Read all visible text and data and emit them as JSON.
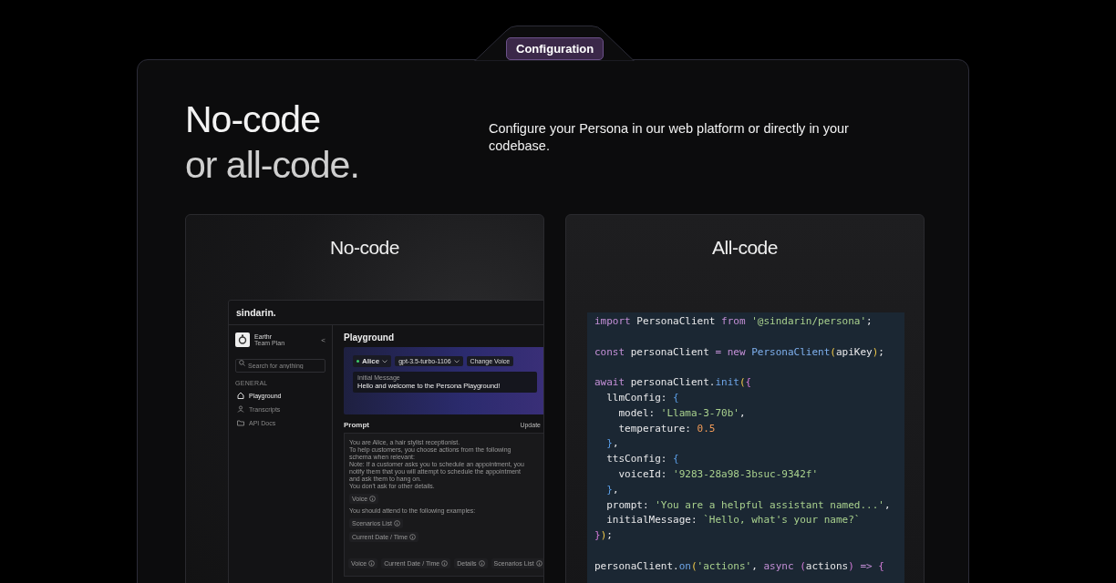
{
  "badge": "Configuration",
  "heading": [
    "No-code",
    "or all-code."
  ],
  "description": "Configure your Persona in our web platform or directly in your codebase.",
  "no_code_card": {
    "title": "No-code",
    "app": {
      "logo": "sindarin.",
      "workspace": {
        "name": "Earthr",
        "plan": "Team Plan",
        "collapse": "<"
      },
      "search": {
        "placeholder": "Search for anything"
      },
      "section": "GENERAL",
      "nav": [
        {
          "label": "Playground",
          "selected": true
        },
        {
          "label": "Transcripts",
          "selected": false
        },
        {
          "label": "API Docs",
          "selected": false
        }
      ],
      "page_title": "Playground",
      "persona": "Alice",
      "model": "gpt-3.5-turbo-1106",
      "change_voice": "Change Voice",
      "initial_message": {
        "label": "Initial Message",
        "value": "Hello and welcome to the Persona Playground!"
      },
      "prompt_title": "Prompt",
      "update": "Update",
      "prompt": [
        {
          "kind": "text",
          "text": "You are Alice, a hair stylist receptionist.\nTo help customers, you choose actions from the following\nschema when relevant:\nNote: If a customer asks you to schedule an appointment, you\nnotify them that you will attempt to schedule the appointment\nand ask them to hang on.\nYou don't ask for other details."
        },
        {
          "kind": "chip",
          "text": "Voice"
        },
        {
          "kind": "text",
          "text": "You should attend to the following examples:"
        },
        {
          "kind": "chip",
          "text": "Scenarios List"
        },
        {
          "kind": "chip",
          "text": "Current Date / Time"
        }
      ],
      "variables": [
        "Voice",
        "Current Date / Time",
        "Details",
        "Scenarios List"
      ]
    }
  },
  "all_code_card": {
    "title": "All-code",
    "code": [
      {
        "kind": "code",
        "tokens": [
          {
            "kind": "kw",
            "text": "import"
          },
          {
            "kind": "id",
            "text": " PersonaClient "
          },
          {
            "kind": "kw",
            "text": "from"
          },
          {
            "kind": "str",
            "text": " '@sindarin/persona'"
          },
          {
            "kind": "id",
            "text": ";"
          }
        ]
      },
      {
        "kind": "blank"
      },
      {
        "kind": "code",
        "tokens": [
          {
            "kind": "kw",
            "text": "const"
          },
          {
            "kind": "id",
            "text": " personaClient "
          },
          {
            "kind": "op",
            "text": "="
          },
          {
            "kind": "kw",
            "text": " new "
          },
          {
            "kind": "cls",
            "text": "PersonaClient"
          },
          {
            "kind": "p1",
            "text": "("
          },
          {
            "kind": "id",
            "text": "apiKey"
          },
          {
            "kind": "p1",
            "text": ")"
          },
          {
            "kind": "id",
            "text": ";"
          }
        ]
      },
      {
        "kind": "blank"
      },
      {
        "kind": "code",
        "tokens": [
          {
            "kind": "kw",
            "text": "await"
          },
          {
            "kind": "id",
            "text": " personaClient."
          },
          {
            "kind": "fn",
            "text": "init"
          },
          {
            "kind": "p1",
            "text": "("
          },
          {
            "kind": "p2",
            "text": "{"
          }
        ]
      },
      {
        "kind": "code",
        "tokens": [
          {
            "kind": "id",
            "text": "  llmConfig: "
          },
          {
            "kind": "p3",
            "text": "{"
          }
        ]
      },
      {
        "kind": "code",
        "tokens": [
          {
            "kind": "id",
            "text": "    model: "
          },
          {
            "kind": "str",
            "text": "'Llama-3-70b'"
          },
          {
            "kind": "id",
            "text": ","
          }
        ]
      },
      {
        "kind": "code",
        "tokens": [
          {
            "kind": "id",
            "text": "    temperature: "
          },
          {
            "kind": "num",
            "text": "0.5"
          }
        ]
      },
      {
        "kind": "code",
        "tokens": [
          {
            "kind": "p3",
            "text": "  }"
          },
          {
            "kind": "id",
            "text": ","
          }
        ]
      },
      {
        "kind": "code",
        "tokens": [
          {
            "kind": "id",
            "text": "  ttsConfig: "
          },
          {
            "kind": "p3",
            "text": "{"
          }
        ]
      },
      {
        "kind": "code",
        "tokens": [
          {
            "kind": "id",
            "text": "    voiceId: "
          },
          {
            "kind": "str",
            "text": "'9283-28a98-3bsuc-9342f'"
          }
        ]
      },
      {
        "kind": "code",
        "tokens": [
          {
            "kind": "p3",
            "text": "  }"
          },
          {
            "kind": "id",
            "text": ","
          }
        ]
      },
      {
        "kind": "code",
        "tokens": [
          {
            "kind": "id",
            "text": "  prompt: "
          },
          {
            "kind": "str",
            "text": "'You are a helpful assistant named...'"
          },
          {
            "kind": "id",
            "text": ","
          }
        ]
      },
      {
        "kind": "code",
        "tokens": [
          {
            "kind": "id",
            "text": "  initialMessage: "
          },
          {
            "kind": "str",
            "text": "`Hello, what's your name?`"
          }
        ]
      },
      {
        "kind": "code",
        "tokens": [
          {
            "kind": "p2",
            "text": "}"
          },
          {
            "kind": "p1",
            "text": ")"
          },
          {
            "kind": "id",
            "text": ";"
          }
        ]
      },
      {
        "kind": "blank"
      },
      {
        "kind": "code",
        "tokens": [
          {
            "kind": "id",
            "text": "personaClient."
          },
          {
            "kind": "fn",
            "text": "on"
          },
          {
            "kind": "p1",
            "text": "("
          },
          {
            "kind": "str",
            "text": "'actions'"
          },
          {
            "kind": "id",
            "text": ", "
          },
          {
            "kind": "kw",
            "text": "async "
          },
          {
            "kind": "p2",
            "text": "("
          },
          {
            "kind": "id",
            "text": "actions"
          },
          {
            "kind": "p2",
            "text": ")"
          },
          {
            "kind": "op",
            "text": " => "
          },
          {
            "kind": "p2",
            "text": "{"
          }
        ]
      }
    ]
  }
}
